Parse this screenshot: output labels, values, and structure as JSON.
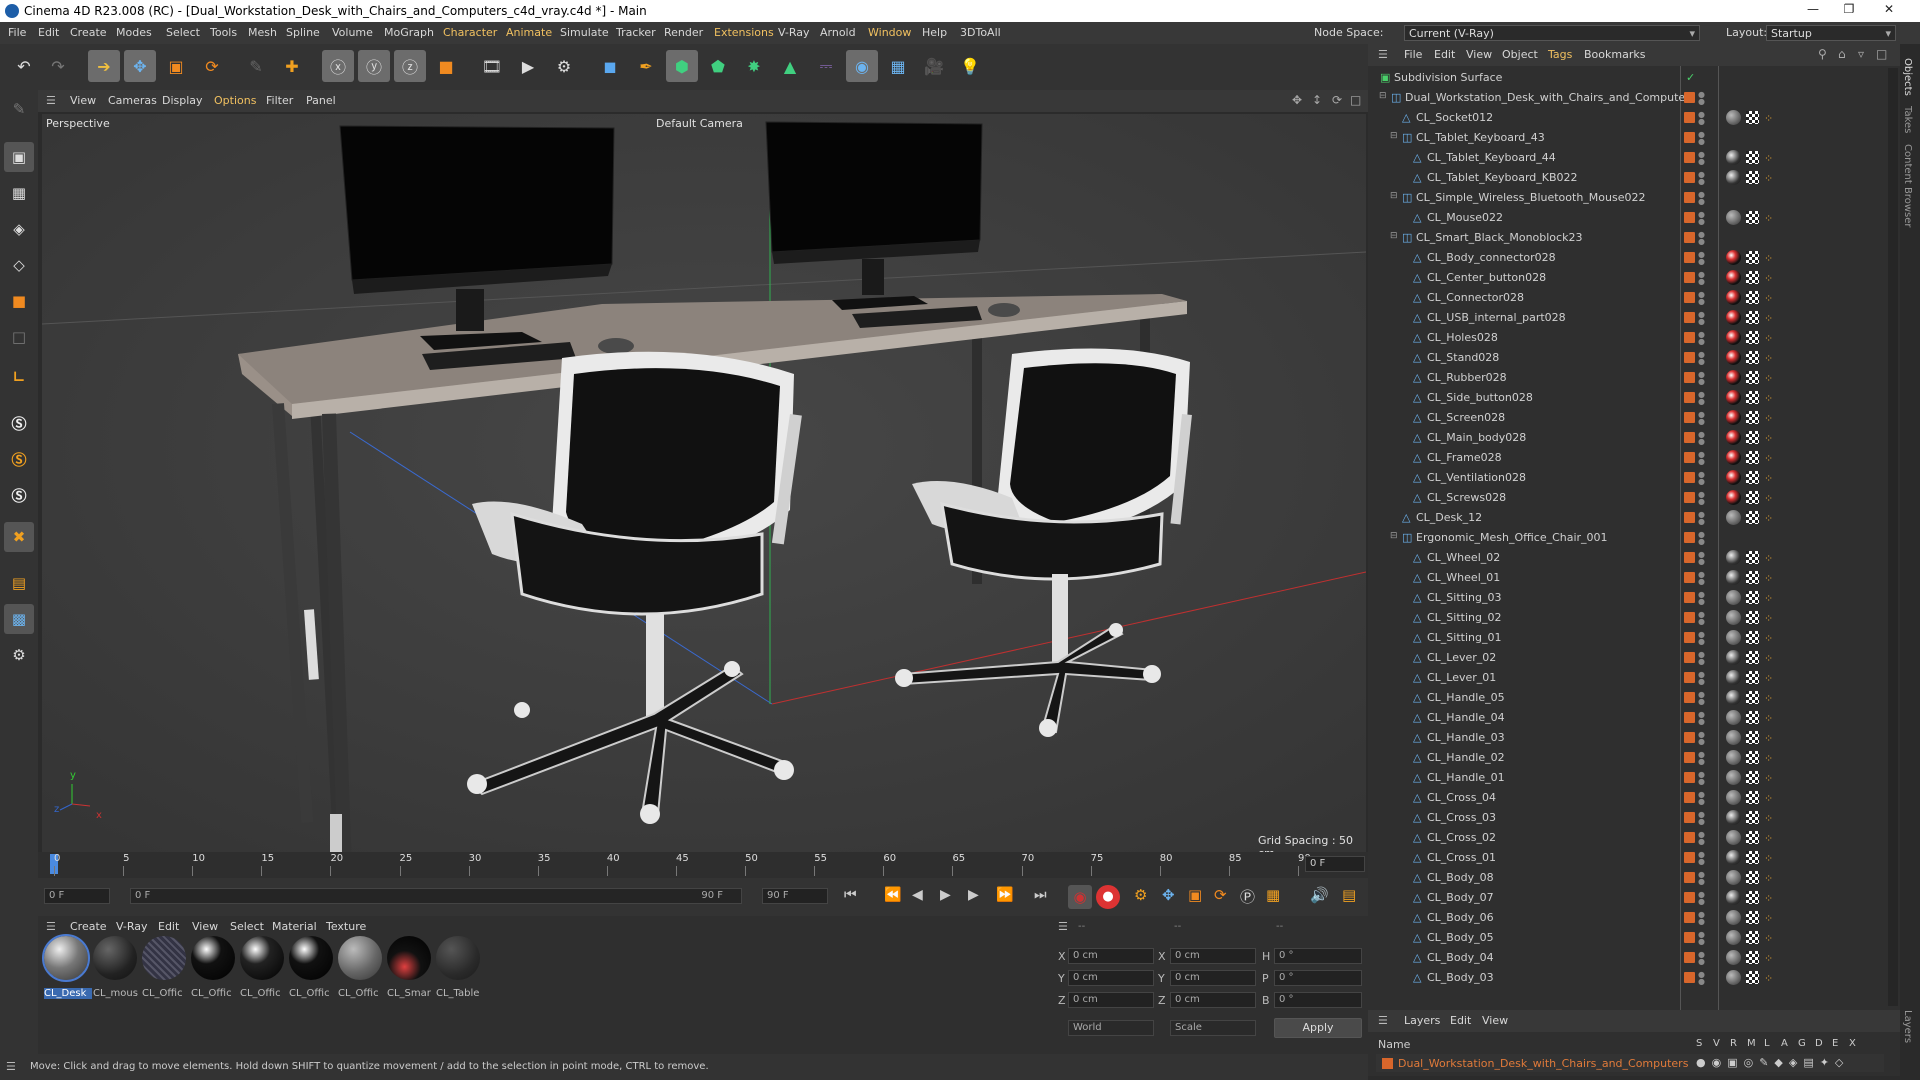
{
  "window": {
    "title": "Cinema 4D R23.008 (RC) - [Dual_Workstation_Desk_with_Chairs_and_Computers_c4d_vray.c4d *] - Main"
  },
  "menubar": {
    "items": [
      "File",
      "Edit",
      "Create",
      "Modes",
      "Select",
      "Tools",
      "Mesh",
      "Spline",
      "Volume",
      "MoGraph",
      "Character",
      "Animate",
      "Simulate",
      "Tracker",
      "Render",
      "Extensions",
      "V-Ray",
      "Arnold",
      "Window",
      "Help",
      "3DToAll"
    ],
    "node_space_label": "Node Space:",
    "node_space_value": "Current (V-Ray)",
    "layout_label": "Layout:",
    "layout_value": "Startup"
  },
  "viewport": {
    "menu": [
      "View",
      "Cameras",
      "Display",
      "Options",
      "Filter",
      "Panel"
    ],
    "label": "Perspective",
    "camera": "Default Camera",
    "grid_spacing": "Grid Spacing : 50 cm",
    "axis_x": "x",
    "axis_y": "y",
    "axis_z": "z"
  },
  "timeline": {
    "ticks": [
      "0",
      "5",
      "10",
      "15",
      "20",
      "25",
      "30",
      "35",
      "40",
      "45",
      "50",
      "55",
      "60",
      "65",
      "70",
      "75",
      "80",
      "85",
      "90"
    ],
    "current_right": "0 F"
  },
  "transport": {
    "start": "0 F",
    "current": "0 F",
    "end": "90 F",
    "max": "90 F"
  },
  "materials": {
    "menu": [
      "Create",
      "V-Ray",
      "Edit",
      "View",
      "Select",
      "Material",
      "Texture"
    ],
    "items": [
      {
        "label": "CL_Desk"
      },
      {
        "label": "CL_mous"
      },
      {
        "label": "CL_Offic"
      },
      {
        "label": "CL_Offic"
      },
      {
        "label": "CL_Offic"
      },
      {
        "label": "CL_Offic"
      },
      {
        "label": "CL_Offic"
      },
      {
        "label": "CL_Smar"
      },
      {
        "label": "CL_Table"
      }
    ]
  },
  "attributes": {
    "fields": {
      "x1": "0 cm",
      "y1": "0 cm",
      "z1": "0 cm",
      "x2": "0 cm",
      "y2": "0 cm",
      "z2": "0 cm",
      "h": "0 °",
      "p": "0 °",
      "b": "0 °"
    },
    "labels": {
      "x": "X",
      "y": "Y",
      "z": "Z",
      "h": "H",
      "p": "P",
      "b": "B"
    },
    "world": "World",
    "scale": "Scale",
    "apply": "Apply",
    "dash1": "--",
    "dash2": "--",
    "dash3": "--"
  },
  "objects": {
    "menu": [
      "File",
      "Edit",
      "View",
      "Object",
      "Tags",
      "Bookmarks"
    ],
    "rows": [
      {
        "name": "Subdivision Surface",
        "level": 0,
        "tag": "none"
      },
      {
        "name": "Dual_Workstation_Desk_with_Chairs_and_Computers",
        "level": 1,
        "tag": "none"
      },
      {
        "name": "CL_Socket012",
        "level": 2,
        "tag": "grey"
      },
      {
        "name": "CL_Tablet_Keyboard_43",
        "level": 2,
        "tag": "none"
      },
      {
        "name": "CL_Tablet_Keyboard_44",
        "level": 3,
        "tag": "black"
      },
      {
        "name": "CL_Tablet_Keyboard_KB022",
        "level": 3,
        "tag": "black"
      },
      {
        "name": "CL_Simple_Wireless_Bluetooth_Mouse022",
        "level": 2,
        "tag": "none"
      },
      {
        "name": "CL_Mouse022",
        "level": 3,
        "tag": "grey"
      },
      {
        "name": "CL_Smart_Black_Monoblock23",
        "level": 2,
        "tag": "none"
      },
      {
        "name": "CL_Body_connector028",
        "level": 3,
        "tag": "red"
      },
      {
        "name": "CL_Center_button028",
        "level": 3,
        "tag": "red"
      },
      {
        "name": "CL_Connector028",
        "level": 3,
        "tag": "red"
      },
      {
        "name": "CL_USB_internal_part028",
        "level": 3,
        "tag": "red"
      },
      {
        "name": "CL_Holes028",
        "level": 3,
        "tag": "red"
      },
      {
        "name": "CL_Stand028",
        "level": 3,
        "tag": "red"
      },
      {
        "name": "CL_Rubber028",
        "level": 3,
        "tag": "red"
      },
      {
        "name": "CL_Side_button028",
        "level": 3,
        "tag": "red"
      },
      {
        "name": "CL_Screen028",
        "level": 3,
        "tag": "red"
      },
      {
        "name": "CL_Main_body028",
        "level": 3,
        "tag": "red"
      },
      {
        "name": "CL_Frame028",
        "level": 3,
        "tag": "red"
      },
      {
        "name": "CL_Ventilation028",
        "level": 3,
        "tag": "red"
      },
      {
        "name": "CL_Screws028",
        "level": 3,
        "tag": "red"
      },
      {
        "name": "CL_Desk_12",
        "level": 2,
        "tag": "grey"
      },
      {
        "name": "Ergonomic_Mesh_Office_Chair_001",
        "level": 2,
        "tag": "none"
      },
      {
        "name": "CL_Wheel_02",
        "level": 3,
        "tag": "black"
      },
      {
        "name": "CL_Wheel_01",
        "level": 3,
        "tag": "black"
      },
      {
        "name": "CL_Sitting_03",
        "level": 3,
        "tag": "grey"
      },
      {
        "name": "CL_Sitting_02",
        "level": 3,
        "tag": "grey"
      },
      {
        "name": "CL_Sitting_01",
        "level": 3,
        "tag": "grey"
      },
      {
        "name": "CL_Lever_02",
        "level": 3,
        "tag": "black"
      },
      {
        "name": "CL_Lever_01",
        "level": 3,
        "tag": "black"
      },
      {
        "name": "CL_Handle_05",
        "level": 3,
        "tag": "black"
      },
      {
        "name": "CL_Handle_04",
        "level": 3,
        "tag": "grey"
      },
      {
        "name": "CL_Handle_03",
        "level": 3,
        "tag": "grey"
      },
      {
        "name": "CL_Handle_02",
        "level": 3,
        "tag": "grey"
      },
      {
        "name": "CL_Handle_01",
        "level": 3,
        "tag": "grey"
      },
      {
        "name": "CL_Cross_04",
        "level": 3,
        "tag": "grey"
      },
      {
        "name": "CL_Cross_03",
        "level": 3,
        "tag": "black"
      },
      {
        "name": "CL_Cross_02",
        "level": 3,
        "tag": "grey"
      },
      {
        "name": "CL_Cross_01",
        "level": 3,
        "tag": "black"
      },
      {
        "name": "CL_Body_08",
        "level": 3,
        "tag": "grey"
      },
      {
        "name": "CL_Body_07",
        "level": 3,
        "tag": "black"
      },
      {
        "name": "CL_Body_06",
        "level": 3,
        "tag": "grey"
      },
      {
        "name": "CL_Body_05",
        "level": 3,
        "tag": "grey"
      },
      {
        "name": "CL_Body_04",
        "level": 3,
        "tag": "grey"
      },
      {
        "name": "CL_Body_03",
        "level": 3,
        "tag": "grey"
      }
    ]
  },
  "side_tabs": [
    "Objects",
    "Takes",
    "Content Browser",
    "Layers"
  ],
  "layers": {
    "menu": [
      "Layers",
      "Edit",
      "View"
    ],
    "name_header": "Name",
    "flags": [
      "S",
      "V",
      "R",
      "M",
      "L",
      "A",
      "G",
      "D",
      "E",
      "X"
    ],
    "layer_name": "Dual_Workstation_Desk_with_Chairs_and_Computers"
  },
  "status": {
    "text": "Move: Click and drag to move elements. Hold down SHIFT to quantize movement / add to the selection in point mode, CTRL to remove."
  }
}
